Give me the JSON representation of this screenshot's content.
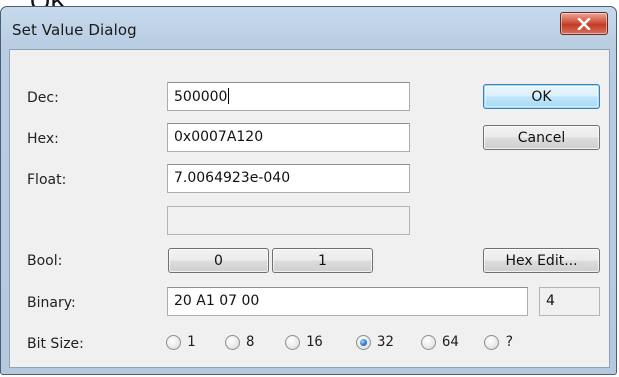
{
  "top_fragment": "OK",
  "window": {
    "title": "Set Value Dialog",
    "close_icon": "close-x-icon"
  },
  "fields": {
    "dec_label": "Dec:",
    "dec_value": "500000",
    "hex_label": "Hex:",
    "hex_value": "0x0007A120",
    "float_label": "Float:",
    "float_value": "7.0064923e-040",
    "extra_value": "",
    "bool_label": "Bool:",
    "binary_label": "Binary:",
    "binary_value": "20 A1 07 00",
    "byte_count": "4",
    "bitsize_label": "Bit Size:"
  },
  "buttons": {
    "ok": "OK",
    "cancel": "Cancel",
    "bool_0": "0",
    "bool_1": "1",
    "hex_edit": "Hex Edit..."
  },
  "bit_sizes": {
    "options": [
      "1",
      "8",
      "16",
      "32",
      "64",
      "?"
    ],
    "selected": "32"
  },
  "colors": {
    "title_gradient_top": "#c7d9ec",
    "close_red": "#c23b24",
    "radio_selected": "#2a73c9"
  }
}
